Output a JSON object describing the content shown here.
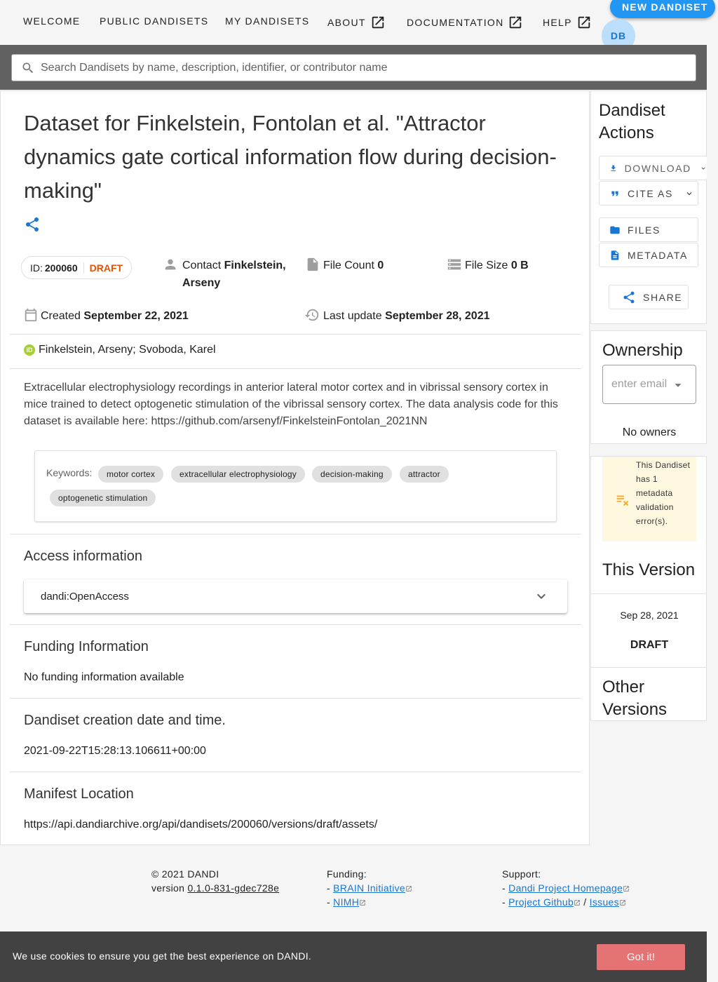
{
  "nav": {
    "items": [
      {
        "label": "WELCOME",
        "external": false
      },
      {
        "label": "PUBLIC DANDISETS",
        "external": false
      },
      {
        "label": "MY DANDISETS",
        "external": false
      },
      {
        "label": "ABOUT",
        "external": true
      },
      {
        "label": "DOCUMENTATION",
        "external": true
      },
      {
        "label": "HELP",
        "external": true
      }
    ],
    "new_dandiset": "NEW DANDISET",
    "avatar_initials": "DB"
  },
  "search": {
    "placeholder": "Search Dandisets by name, description, identifier, or contributor name"
  },
  "dandiset": {
    "title": "Dataset for Finkelstein, Fontolan et al. \"Attractor dynamics gate cortical information flow during decision-making\"",
    "id_label": "ID:",
    "id": "200060",
    "status": "DRAFT",
    "contact_label": "Contact",
    "contact_name": "Finkelstein, Arseny",
    "file_count_label": "File Count",
    "file_count": "0",
    "file_size_label": "File Size",
    "file_size": "0 B",
    "created_label": "Created",
    "created": "September 22, 2021",
    "updated_label": "Last update",
    "updated": "September 28, 2021",
    "orcid_badge": "iD",
    "contributors": "Finkelstein, Arseny; Svoboda, Karel",
    "description": "Extracellular electrophysiology recordings in anterior lateral motor cortex and in vibrissal sensory cortex in mice trained to detect optogenetic stimulation of the vibrissal sensory cortex. The data analysis code for this dataset is available here: https://github.com/arsenyf/FinkelsteinFontolan_2021NN",
    "keywords_label": "Keywords:",
    "keywords": [
      "motor cortex",
      "extracellular electrophysiology",
      "decision-making",
      "attractor",
      "optogenetic stimulation"
    ]
  },
  "sections": {
    "access_title": "Access information",
    "access_value": "dandi:OpenAccess",
    "funding_title": "Funding Information",
    "funding_value": "No funding information available",
    "creation_title": "Dandiset creation date and time.",
    "creation_value": "2021-09-22T15:28:13.106611+00:00",
    "manifest_title": "Manifest Location",
    "manifest_value": "https://api.dandiarchive.org/api/dandisets/200060/versions/draft/assets/"
  },
  "sidebar": {
    "actions_title": "Dandiset Actions",
    "download": "DOWNLOAD",
    "cite_as": "CITE AS",
    "files": "FILES",
    "metadata": "METADATA",
    "share": "SHARE",
    "ownership_title": "Ownership",
    "owner_placeholder": "enter email",
    "no_owners": "No owners",
    "validation_warning": "This Dandiset has 1 metadata validation error(s).",
    "this_version_title": "This Version",
    "version_date": "Sep 28, 2021",
    "version_name": "DRAFT",
    "other_versions_title": "Other Versions"
  },
  "footer": {
    "copyright": "© 2021 DANDI",
    "version_label": "version",
    "version": "0.1.0-831-gdec728e",
    "funding_label": "Funding:",
    "funding_links": [
      "BRAIN Initiative",
      "NIMH"
    ],
    "support_label": "Support:",
    "support_links": [
      "Dandi Project Homepage",
      "Project Github",
      "Issues"
    ]
  },
  "cookie": {
    "text": "We use cookies to ensure you get the best experience on DANDI.",
    "button": "Got it!"
  },
  "colors": {
    "primary": "#2196f3",
    "draft": "#e65100",
    "warning_bg": "#fff8e1",
    "warning_icon": "#f9a825",
    "cookie_btn": "#e57373"
  }
}
